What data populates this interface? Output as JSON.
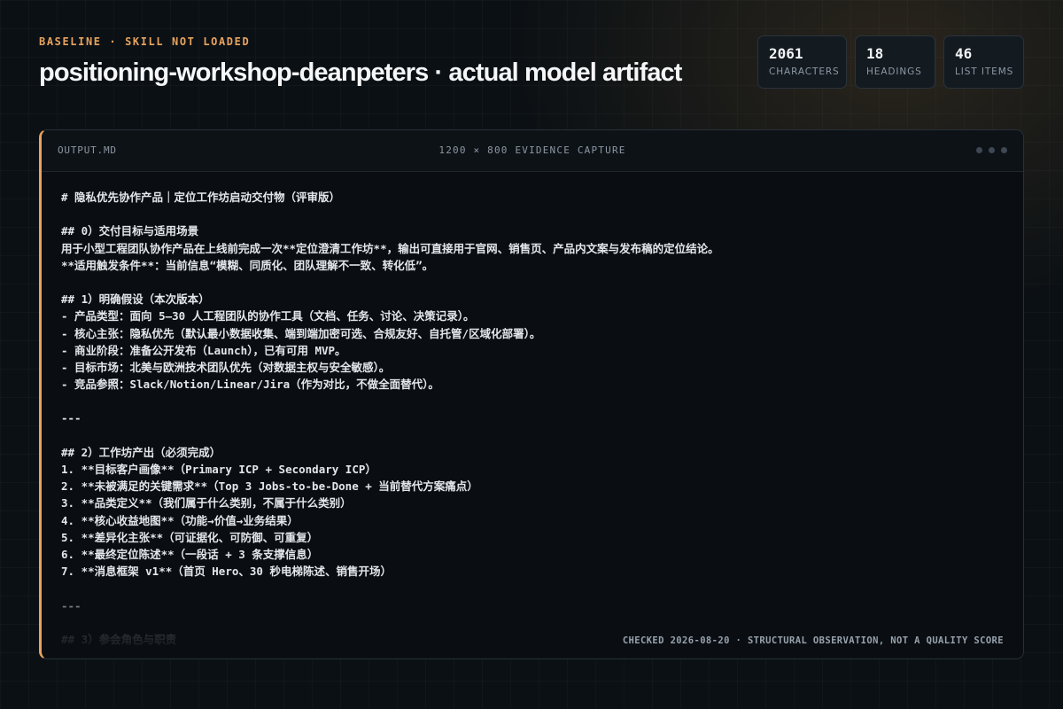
{
  "header": {
    "eyebrow": "BASELINE · SKILL NOT LOADED",
    "title": "positioning-workshop-deanpeters · actual model artifact"
  },
  "stats": [
    {
      "value": "2061",
      "label": "CHARACTERS"
    },
    {
      "value": "18",
      "label": "HEADINGS"
    },
    {
      "value": "46",
      "label": "LIST ITEMS"
    }
  ],
  "window": {
    "file_name": "OUTPUT.MD",
    "capture_label": "1200 × 800 EVIDENCE CAPTURE",
    "footer_note": "CHECKED 2026-08-20 · STRUCTURAL OBSERVATION, NOT A QUALITY SCORE",
    "lines": [
      "# 隐私优先协作产品｜定位工作坊启动交付物（评审版）",
      "",
      "## 0）交付目标与适用场景",
      "用于小型工程团队协作产品在上线前完成一次**定位澄清工作坊**，输出可直接用于官网、销售页、产品内文案与发布稿的定位结论。",
      "**适用触发条件**：当前信息“模糊、同质化、团队理解不一致、转化低”。",
      "",
      "## 1）明确假设（本次版本）",
      "- 产品类型：面向 5–30 人工程团队的协作工具（文档、任务、讨论、决策记录）。",
      "- 核心主张：隐私优先（默认最小数据收集、端到端加密可选、合规友好、自托管/区域化部署）。",
      "- 商业阶段：准备公开发布（Launch），已有可用 MVP。",
      "- 目标市场：北美与欧洲技术团队优先（对数据主权与安全敏感）。",
      "- 竞品参照：Slack/Notion/Linear/Jira（作为对比，不做全面替代）。",
      "",
      "---",
      "",
      "## 2）工作坊产出（必须完成）",
      "1. **目标客户画像**（Primary ICP + Secondary ICP）",
      "2. **未被满足的关键需求**（Top 3 Jobs-to-be-Done + 当前替代方案痛点）",
      "3. **品类定义**（我们属于什么类别，不属于什么类别）",
      "4. **核心收益地图**（功能→价值→业务结果）",
      "5. **差异化主张**（可证据化、可防御、可重复）",
      "6. **最终定位陈述**（一段话 + 3 条支撑信息）",
      "7. **消息框架 v1**（首页 Hero、30 秒电梯陈述、销售开场）",
      "",
      "---",
      "",
      "## 3）参会角色与职责"
    ]
  }
}
